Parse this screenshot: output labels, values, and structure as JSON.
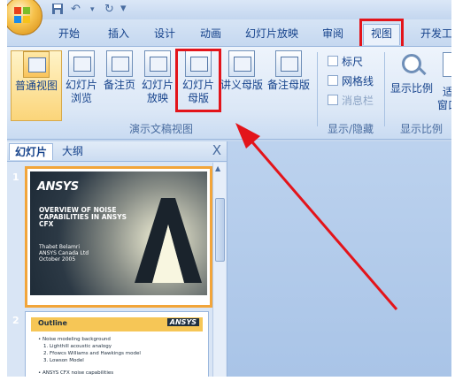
{
  "qat": {
    "save_icon": "save-icon",
    "undo_icon": "undo-icon",
    "redo_icon": "redo-icon",
    "more": "▾"
  },
  "tabs": [
    {
      "label": "开始"
    },
    {
      "label": "插入"
    },
    {
      "label": "设计"
    },
    {
      "label": "动画"
    },
    {
      "label": "幻灯片放映"
    },
    {
      "label": "审阅"
    },
    {
      "label": "视图",
      "active": true
    },
    {
      "label": "开发工"
    }
  ],
  "ribbon": {
    "presentation_views": {
      "group_label": "演示文稿视图",
      "buttons": [
        {
          "label": "普通视图",
          "active": true
        },
        {
          "label1": "幻灯片",
          "label2": "浏览"
        },
        {
          "label": "备注页"
        },
        {
          "label1": "幻灯片",
          "label2": "放映"
        },
        {
          "label1": "幻灯片",
          "label2": "母版"
        },
        {
          "label": "讲义母版"
        },
        {
          "label": "备注母版"
        }
      ]
    },
    "show_hide": {
      "group_label": "显示/隐藏",
      "items": [
        {
          "label": "标尺",
          "checked": false
        },
        {
          "label": "网格线",
          "checked": false
        },
        {
          "label": "消息栏",
          "checked": false,
          "disabled": true
        }
      ]
    },
    "zoom": {
      "group_label": "显示比例",
      "label": "显示比例",
      "partial_label1": "适",
      "partial_label2": "窗口"
    }
  },
  "pane": {
    "tabs": [
      {
        "label": "幻灯片",
        "active": true
      },
      {
        "label": "大纲"
      }
    ],
    "close": "X",
    "slides": [
      {
        "number": "1",
        "logo": "ANSYS",
        "title": "OVERVIEW OF NOISE CAPABILITIES IN ANSYS CFX",
        "sub1": "Thabet Belamri",
        "sub2": "ANSYS Canada Ltd",
        "sub3": "October 2005"
      },
      {
        "number": "2",
        "title": "Outline",
        "logo": "ANSYS",
        "lines": [
          "• Noise modeling background",
          "1. Lighthill acoustic analogy",
          "2. Ffowcs Williams and Hawkings model",
          "3. Lowson Model",
          "• ANSYS CFX noise capabilities"
        ]
      }
    ]
  },
  "colors": {
    "annotation_red": "#e3141a",
    "ribbon_text": "#15428b"
  }
}
